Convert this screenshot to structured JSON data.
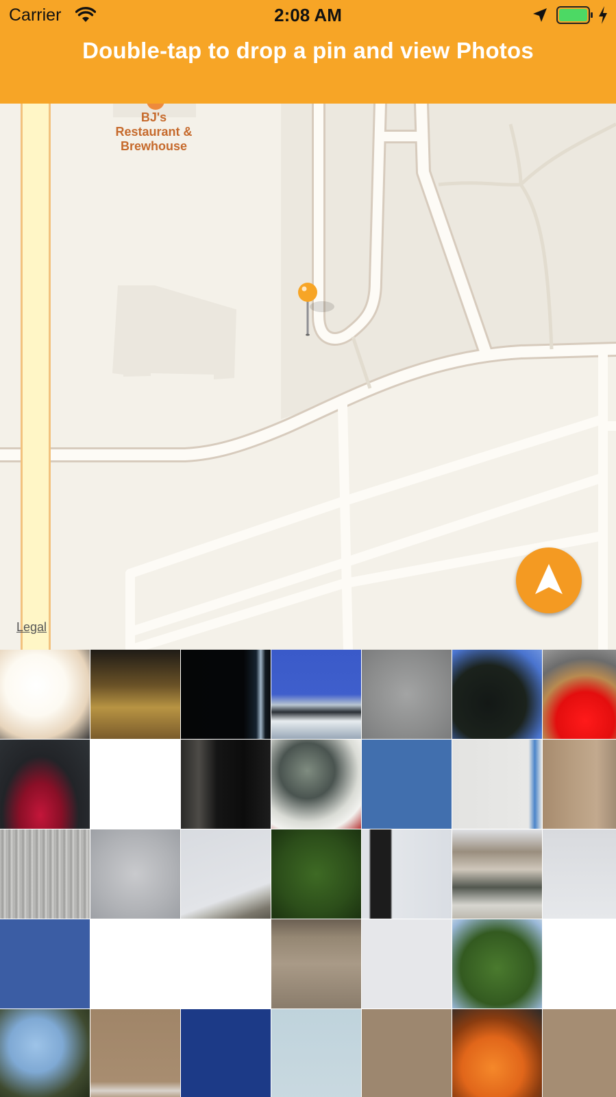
{
  "status_bar": {
    "carrier": "Carrier",
    "time": "2:08 AM",
    "icons": [
      "wifi-icon",
      "location-arrow-icon",
      "battery-icon",
      "charging-bolt-icon"
    ]
  },
  "header": {
    "title": "Double-tap to drop a pin and view Photos",
    "color": "#f7a526"
  },
  "map": {
    "poi_label": "BJ's\nRestaurant &\nBrewhouse",
    "legal": "Legal",
    "pin_color": "#f7a526",
    "locate_button_icon": "navigation-arrow-icon",
    "locate_button_color": "#f49a22"
  },
  "photo_grid": {
    "columns": 7,
    "rows": 5,
    "photos": [
      {
        "desc": "blurry-light"
      },
      {
        "desc": "brown-surface"
      },
      {
        "desc": "dark-blue-streak"
      },
      {
        "desc": "blue-sky-building"
      },
      {
        "desc": "concrete-pillar"
      },
      {
        "desc": "tree-sky"
      },
      {
        "desc": "person-red"
      },
      {
        "desc": "red-car"
      },
      {
        "desc": "white"
      },
      {
        "desc": "dark-figure"
      },
      {
        "desc": "car-interior"
      },
      {
        "desc": "blue-sky"
      },
      {
        "desc": "white-wall"
      },
      {
        "desc": "building-balcony"
      },
      {
        "desc": "wood-grain"
      },
      {
        "desc": "gray-clouds"
      },
      {
        "desc": "sky-roof"
      },
      {
        "desc": "green-tree"
      },
      {
        "desc": "traffic-light"
      },
      {
        "desc": "building-windows"
      },
      {
        "desc": "gray-sky"
      },
      {
        "desc": "deep-blue"
      },
      {
        "desc": "white-blank"
      },
      {
        "desc": "white-blank-2"
      },
      {
        "desc": "concrete-ledge"
      },
      {
        "desc": "pale-gray"
      },
      {
        "desc": "tree-leaves"
      },
      {
        "desc": "white-blank-3"
      },
      {
        "desc": "tree-branches-sky"
      },
      {
        "desc": "tan-wall-sign"
      },
      {
        "desc": "navy-blue"
      },
      {
        "desc": "light-blue-sky"
      },
      {
        "desc": "tan-wall"
      },
      {
        "desc": "pumpkins"
      },
      {
        "desc": "tan-surface"
      }
    ]
  }
}
